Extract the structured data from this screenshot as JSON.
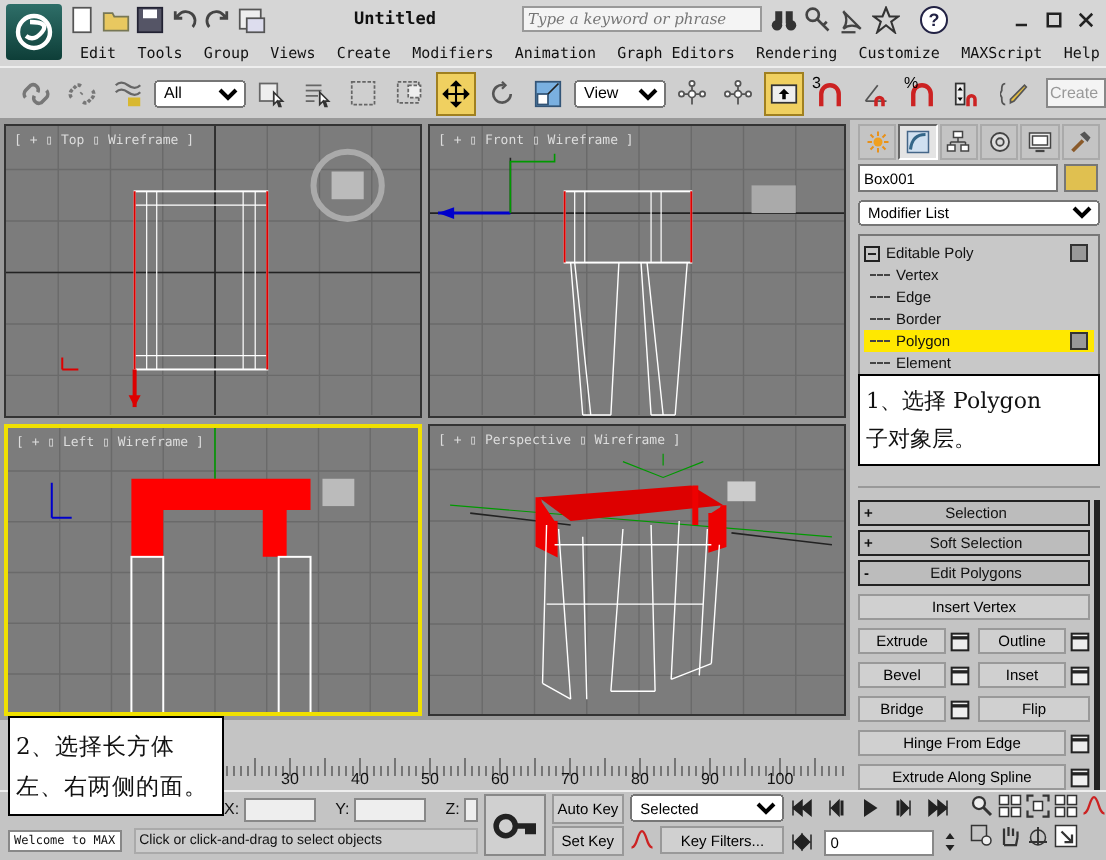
{
  "title_bar": {
    "title": "Untitled",
    "search": {
      "placeholder": "Type a keyword or phrase"
    },
    "help": "?"
  },
  "menu": [
    "Edit",
    "Tools",
    "Group",
    "Views",
    "Create",
    "Modifiers",
    "Animation",
    "Graph Editors",
    "Rendering",
    "Customize",
    "MAXScript",
    "Help"
  ],
  "toolbar": [
    {
      "kind": "link",
      "selected": false
    },
    {
      "kind": "unlink",
      "selected": false
    },
    {
      "kind": "bind",
      "selected": false
    },
    {
      "kind": "dropdown",
      "value": "All"
    },
    {
      "kind": "select",
      "selected": false
    },
    {
      "kind": "select-by-name",
      "selected": false
    },
    {
      "kind": "region",
      "selected": false
    },
    {
      "kind": "crossing",
      "selected": false
    },
    {
      "kind": "move",
      "selected": true
    },
    {
      "kind": "rotate",
      "selected": false
    },
    {
      "kind": "scale",
      "selected": false
    },
    {
      "kind": "dropdown",
      "value": "View"
    },
    {
      "kind": "pivot",
      "selected": false
    },
    {
      "kind": "manipulate",
      "selected": false
    },
    {
      "kind": "shortcut",
      "selected": true
    },
    {
      "kind": "snap",
      "glyph": "3",
      "selected": false
    },
    {
      "kind": "angle-snap",
      "selected": false
    },
    {
      "kind": "percent-snap",
      "glyph": "%",
      "selected": false
    },
    {
      "kind": "spinner-snap",
      "selected": false
    },
    {
      "kind": "named-sets",
      "selected": false
    },
    {
      "kind": "field",
      "placeholder": "Create"
    }
  ],
  "viewports": [
    {
      "kind": "top",
      "label": "[ + ▯ Top ▯ Wireframe ]",
      "selected": false
    },
    {
      "kind": "front",
      "label": "[ + ▯ Front ▯ Wireframe ]",
      "selected": false
    },
    {
      "kind": "left",
      "label": "[ + ▯ Left ▯ Wireframe ]",
      "selected": true
    },
    {
      "kind": "perspective",
      "label": "[ + ▯ Perspective ▯ Wireframe ]",
      "selected": false
    }
  ],
  "command_panel": {
    "tabs": [
      {
        "selected": false
      },
      {
        "selected": true
      },
      {
        "selected": false
      },
      {
        "selected": false
      },
      {
        "selected": false
      },
      {
        "selected": false
      }
    ],
    "object_name": "Box001",
    "modifier_list": "Modifier List",
    "stack": [
      {
        "label": "Editable Poly",
        "expanded": true,
        "selected": false,
        "children": [
          {
            "label": "Vertex",
            "selected": false
          },
          {
            "label": "Edge",
            "selected": false
          },
          {
            "label": "Border",
            "selected": false
          },
          {
            "label": "Polygon",
            "selected": true
          },
          {
            "label": "Element",
            "selected": false
          }
        ]
      }
    ],
    "callout": [
      "1、选择 Polygon",
      "子对象层。"
    ],
    "rollouts": [
      {
        "sign": "+",
        "label": "Selection"
      },
      {
        "sign": "+",
        "label": "Soft Selection"
      },
      {
        "sign": "-",
        "label": "Edit Polygons"
      }
    ],
    "buttons": [
      [
        {
          "label": "Insert Vertex",
          "settings": false
        }
      ],
      [
        {
          "label": "Extrude",
          "settings": true
        },
        {
          "label": "Outline",
          "settings": true
        }
      ],
      [
        {
          "label": "Bevel",
          "settings": true
        },
        {
          "label": "Inset",
          "settings": true
        }
      ],
      [
        {
          "label": "Bridge",
          "settings": true
        },
        {
          "label": "Flip",
          "settings": false
        }
      ],
      [
        {
          "label": "Hinge From Edge",
          "settings": true
        }
      ],
      [
        {
          "label": "Extrude Along Spline",
          "settings": true
        }
      ]
    ]
  },
  "callout": [
    "2、选择长方体",
    "左、右两侧的面。"
  ],
  "timeline": {
    "ticks": [
      "30",
      "40",
      "50",
      "60",
      "70",
      "80",
      "90",
      "100"
    ]
  },
  "status_bar": {
    "listener": "Welcome to MAX",
    "prompt": "Click or click-and-drag to select objects",
    "x_label": "X:",
    "y_label": "Y:",
    "z_label": "Z:",
    "auto_key": "Auto Key",
    "set_key": "Set Key",
    "key_set": "Selected",
    "key_filters": "Key Filters...",
    "frame": "0"
  }
}
